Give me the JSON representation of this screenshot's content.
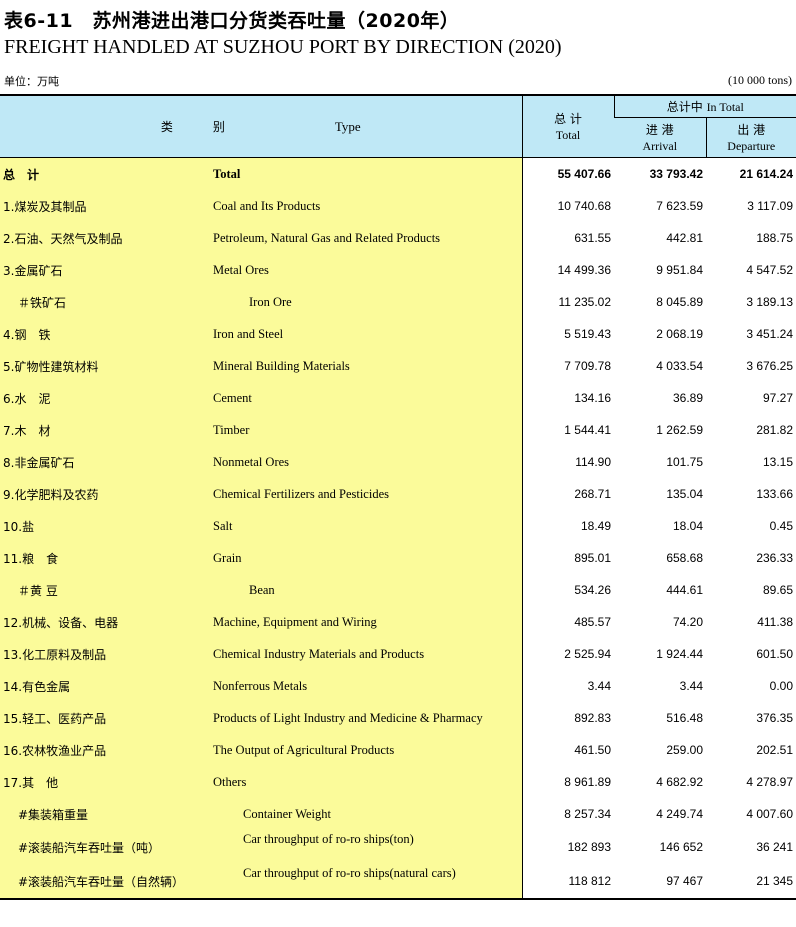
{
  "title_cn": "表6-11　苏州港进出港口分货类吞吐量（2020年）",
  "title_en": "FREIGHT HANDLED AT SUZHOU PORT BY DIRECTION (2020)",
  "unit_cn": "单位：万吨",
  "unit_en": "(10 000 tons)",
  "header": {
    "category_cn": "类　别",
    "category_en": "Type",
    "total_cn": "总 计",
    "total_en": "Total",
    "in_total_cn": "总计中",
    "in_total_en": "In Total",
    "arrival_cn": "进 港",
    "arrival_en": "Arrival",
    "departure_cn": "出 港",
    "departure_en": "Departure"
  },
  "rows": [
    {
      "cn": "总　计",
      "en": "Total",
      "total": "55 407.66",
      "arrival": "33 793.42",
      "departure": "21 614.24",
      "bold": true,
      "indent": 0
    },
    {
      "cn": "1.煤炭及其制品",
      "en": "Coal and Its Products",
      "total": "10 740.68",
      "arrival": "7 623.59",
      "departure": "3 117.09",
      "indent": 0
    },
    {
      "cn": "2.石油、天然气及制品",
      "en": "Petroleum, Natural Gas and Related Products",
      "total": "631.55",
      "arrival": "442.81",
      "departure": "188.75",
      "indent": 0
    },
    {
      "cn": "3.金属矿石",
      "en": "Metal Ores",
      "total": "14 499.36",
      "arrival": "9 951.84",
      "departure": "4 547.52",
      "indent": 0
    },
    {
      "cn": "＃铁矿石",
      "en": "Iron Ore",
      "total": "11 235.02",
      "arrival": "8 045.89",
      "departure": "3 189.13",
      "indent": 1
    },
    {
      "cn": "4.钢　铁",
      "en": "Iron and Steel",
      "total": "5 519.43",
      "arrival": "2 068.19",
      "departure": "3 451.24",
      "indent": 0
    },
    {
      "cn": "5.矿物性建筑材料",
      "en": "Mineral Building Materials",
      "total": "7 709.78",
      "arrival": "4 033.54",
      "departure": "3 676.25",
      "indent": 0
    },
    {
      "cn": "6.水　泥",
      "en": "Cement",
      "total": "134.16",
      "arrival": "36.89",
      "departure": "97.27",
      "indent": 0
    },
    {
      "cn": "7.木　材",
      "en": "Timber",
      "total": "1 544.41",
      "arrival": "1 262.59",
      "departure": "281.82",
      "indent": 0
    },
    {
      "cn": "8.非金属矿石",
      "en": "Nonmetal Ores",
      "total": "114.90",
      "arrival": "101.75",
      "departure": "13.15",
      "indent": 0
    },
    {
      "cn": "9.化学肥料及农药",
      "en": "Chemical Fertilizers and Pesticides",
      "total": "268.71",
      "arrival": "135.04",
      "departure": "133.66",
      "indent": 0
    },
    {
      "cn": "10.盐",
      "en": "Salt",
      "total": "18.49",
      "arrival": "18.04",
      "departure": "0.45",
      "indent": 0
    },
    {
      "cn": "11.粮　食",
      "en": "Grain",
      "total": "895.01",
      "arrival": "658.68",
      "departure": "236.33",
      "indent": 0
    },
    {
      "cn": "＃黄 豆",
      "en": "Bean",
      "total": "534.26",
      "arrival": "444.61",
      "departure": "89.65",
      "indent": 1
    },
    {
      "cn": "12.机械、设备、电器",
      "en": "Machine, Equipment and Wiring",
      "total": "485.57",
      "arrival": "74.20",
      "departure": "411.38",
      "indent": 0
    },
    {
      "cn": "13.化工原料及制品",
      "en": "Chemical Industry Materials and Products",
      "total": "2 525.94",
      "arrival": "1 924.44",
      "departure": "601.50",
      "indent": 0
    },
    {
      "cn": "14.有色金属",
      "en": "Nonferrous Metals",
      "total": "3.44",
      "arrival": "3.44",
      "departure": "0.00",
      "indent": 0
    },
    {
      "cn": "15.轻工、医药产品",
      "en": "Products of Light Industry and Medicine & Pharmacy",
      "total": "892.83",
      "arrival": "516.48",
      "departure": "376.35",
      "indent": 0
    },
    {
      "cn": "16.农林牧渔业产品",
      "en": "The Output of Agricultural Products",
      "total": "461.50",
      "arrival": "259.00",
      "departure": "202.51",
      "indent": 0
    },
    {
      "cn": "17.其　他",
      "en": "Others",
      "total": "8 961.89",
      "arrival": "4 682.92",
      "departure": "4 278.97",
      "indent": 0
    },
    {
      "cn": "#集装箱重量",
      "en": "Container Weight",
      "total": "8 257.34",
      "arrival": "4 249.74",
      "departure": "4 007.60",
      "indent": 2
    },
    {
      "cn": "#滚装船汽车吞吐量（吨）",
      "en": "Car throughput of ro-ro ships(ton)",
      "total": "182 893",
      "arrival": "146 652",
      "departure": "36 241",
      "indent": 3
    },
    {
      "cn": "#滚装船汽车吞吐量（自然辆）",
      "en": "Car throughput of ro-ro ships(natural cars)",
      "total": "118 812",
      "arrival": "97 467",
      "departure": "21 345",
      "indent": 3
    }
  ]
}
